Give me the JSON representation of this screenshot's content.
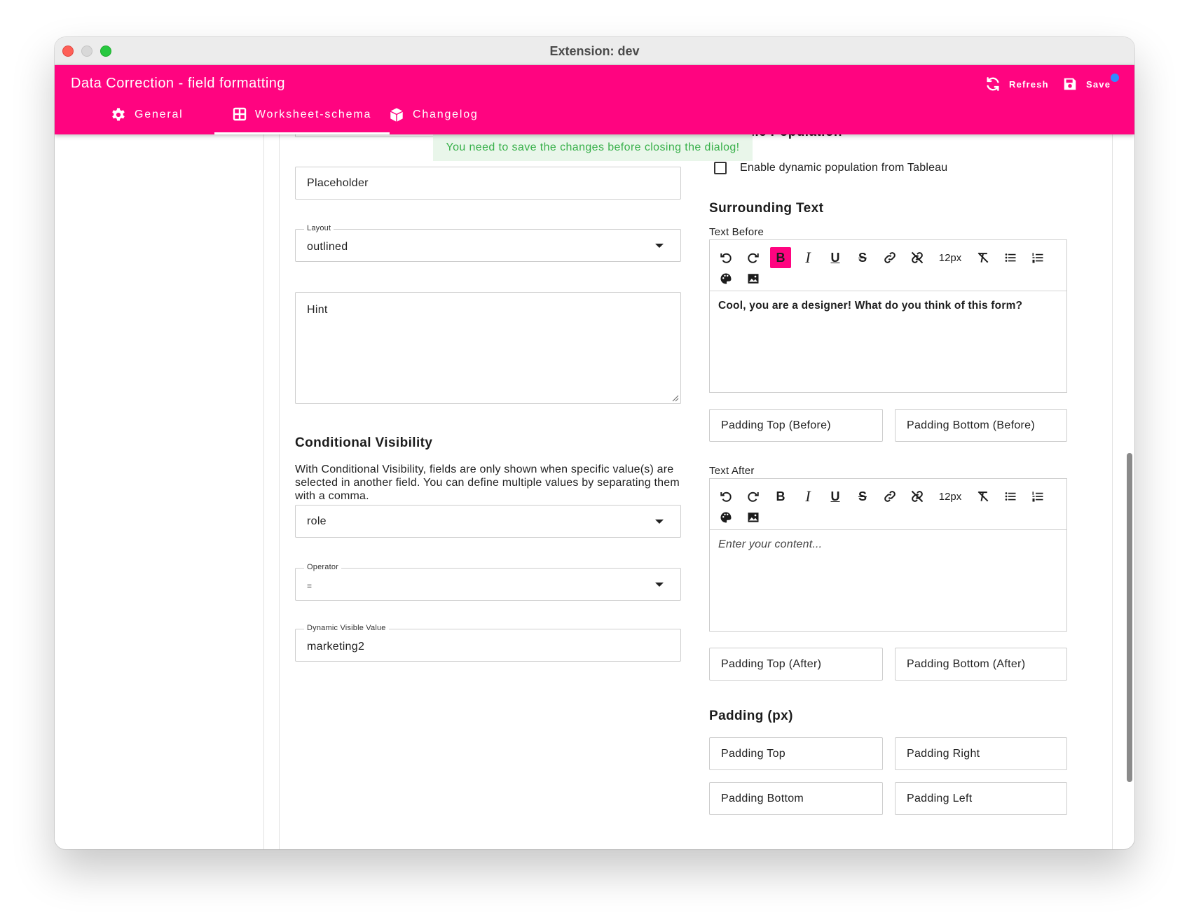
{
  "window": {
    "title": "Extension: dev"
  },
  "appbar": {
    "title": "Data Correction - field formatting",
    "refresh_label": "Refresh",
    "save_label": "Save",
    "accent_color": "#ff0480",
    "indicator_color": "#2f8cff"
  },
  "tabs": [
    {
      "label": "General",
      "icon": "gear-icon"
    },
    {
      "label": "Worksheet-schema",
      "icon": "table-icon",
      "active": true
    },
    {
      "label": "Changelog",
      "icon": "box-icon"
    }
  ],
  "toast": "You need to save the changes before closing the dialog!",
  "left": {
    "placeholder_field": "Placeholder",
    "layout": {
      "label": "Layout",
      "value": "outlined"
    },
    "hint_field": "Hint",
    "conditional": {
      "heading": "Conditional Visibility",
      "description": "With Conditional Visibility, fields are only shown when specific value(s) are selected in another field. You can define multiple values by separating them with a comma.",
      "field_select": "role",
      "operator": {
        "label": "Operator",
        "value": "="
      },
      "dynamic_value": {
        "label": "Dynamic Visible Value",
        "value": "marketing2"
      }
    }
  },
  "right": {
    "dynamic_population": {
      "heading_partial": "Dynamic Population",
      "checkbox_label": "Enable dynamic population from Tableau",
      "checked": false
    },
    "surrounding": {
      "heading": "Surrounding Text",
      "text_before_label": "Text Before",
      "text_before_content": "Cool, you are a designer! What do you think of this form?",
      "padding_top_before": "Padding Top (Before)",
      "padding_bottom_before": "Padding Bottom (Before)",
      "text_after_label": "Text After",
      "text_after_placeholder": "Enter your content...",
      "padding_top_after": "Padding Top (After)",
      "padding_bottom_after": "Padding Bottom (After)"
    },
    "toolbar": {
      "font_size": "12px",
      "buttons": [
        "undo-icon",
        "redo-icon",
        "bold-icon",
        "italic-icon",
        "underline-icon",
        "strikethrough-icon",
        "link-icon",
        "unlink-icon",
        "font-size-select",
        "clear-format-icon",
        "bullet-list-icon",
        "numbered-list-icon",
        "palette-icon",
        "image-icon"
      ]
    },
    "padding": {
      "heading": "Padding (px)",
      "top": "Padding Top",
      "right": "Padding Right",
      "bottom": "Padding Bottom",
      "left": "Padding Left"
    }
  }
}
